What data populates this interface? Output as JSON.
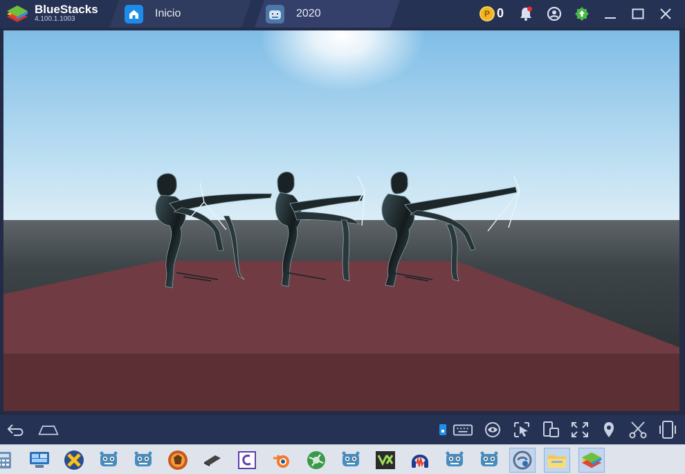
{
  "titlebar": {
    "app_name": "BlueStacks",
    "version": "4.100.1.1003",
    "coin_count": "0"
  },
  "tabs": [
    {
      "label": "Inicio",
      "icon": "home-icon"
    },
    {
      "label": "2020",
      "icon": "godot-icon"
    }
  ],
  "titlebar_buttons": [
    "coin-icon",
    "bell-icon",
    "account-icon",
    "update-icon",
    "minimize-icon",
    "maximize-icon",
    "close-icon"
  ],
  "navbar": {
    "left": [
      "back-icon",
      "home-icon"
    ],
    "right": [
      "keyboard-toggle-icon",
      "keymap-icon",
      "eye-icon",
      "cursor-icon",
      "rotate-icon",
      "fullscreen-icon",
      "location-icon",
      "scissors-icon",
      "phone-icon"
    ]
  },
  "taskbar": [
    "calculator-icon",
    "remote-desktop-icon",
    "x-app-icon",
    "godot-icon",
    "godot-icon",
    "wolf-app-icon",
    "tablet-icon",
    "code-editor-icon",
    "blender-icon",
    "globe-app-icon",
    "godot-icon",
    "vox-icon",
    "audacity-icon",
    "godot-icon",
    "godot-icon",
    "chat-icon",
    "file-explorer-icon",
    "bluestacks-icon"
  ],
  "colors": {
    "titlebar_bg": "#263253",
    "sky_top": "#8ec3e6",
    "sky_horizon": "#d4ebf7",
    "floor": "#703b42",
    "taskbar_bg": "#dfe4ec"
  }
}
